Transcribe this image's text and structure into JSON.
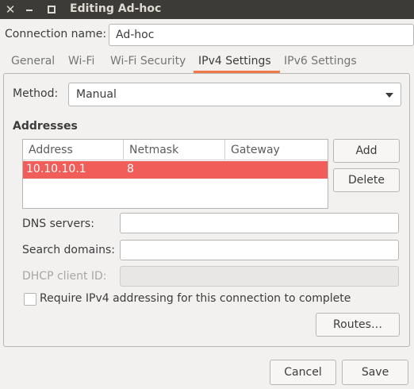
{
  "window": {
    "title": "Editing Ad-hoc",
    "close_glyph": "✕"
  },
  "connection": {
    "label": "Connection name:",
    "value": "Ad-hoc"
  },
  "tabs": [
    {
      "label": "General"
    },
    {
      "label": "Wi-Fi"
    },
    {
      "label": "Wi-Fi Security"
    },
    {
      "label": "IPv4 Settings",
      "active": true
    },
    {
      "label": "IPv6 Settings"
    }
  ],
  "method": {
    "label": "Method:",
    "value": "Manual"
  },
  "addresses": {
    "heading": "Addresses",
    "columns": [
      "Address",
      "Netmask",
      "Gateway"
    ],
    "rows": [
      {
        "address": "10.10.10.1",
        "netmask": "8",
        "gateway": ""
      }
    ],
    "add_label": "Add",
    "delete_label": "Delete"
  },
  "fields": {
    "dns_label": "DNS servers:",
    "dns_value": "",
    "search_label": "Search domains:",
    "search_value": "",
    "dhcp_label": "DHCP client ID:",
    "dhcp_value": ""
  },
  "require_ipv4": {
    "label": "Require IPv4 addressing for this connection to complete",
    "checked": false
  },
  "routes_label": "Routes…",
  "footer": {
    "cancel_label": "Cancel",
    "save_label": "Save"
  },
  "colors": {
    "titlebar": "#3c3b37",
    "accent_underline": "#f07746",
    "selected_row": "#f15d58"
  }
}
